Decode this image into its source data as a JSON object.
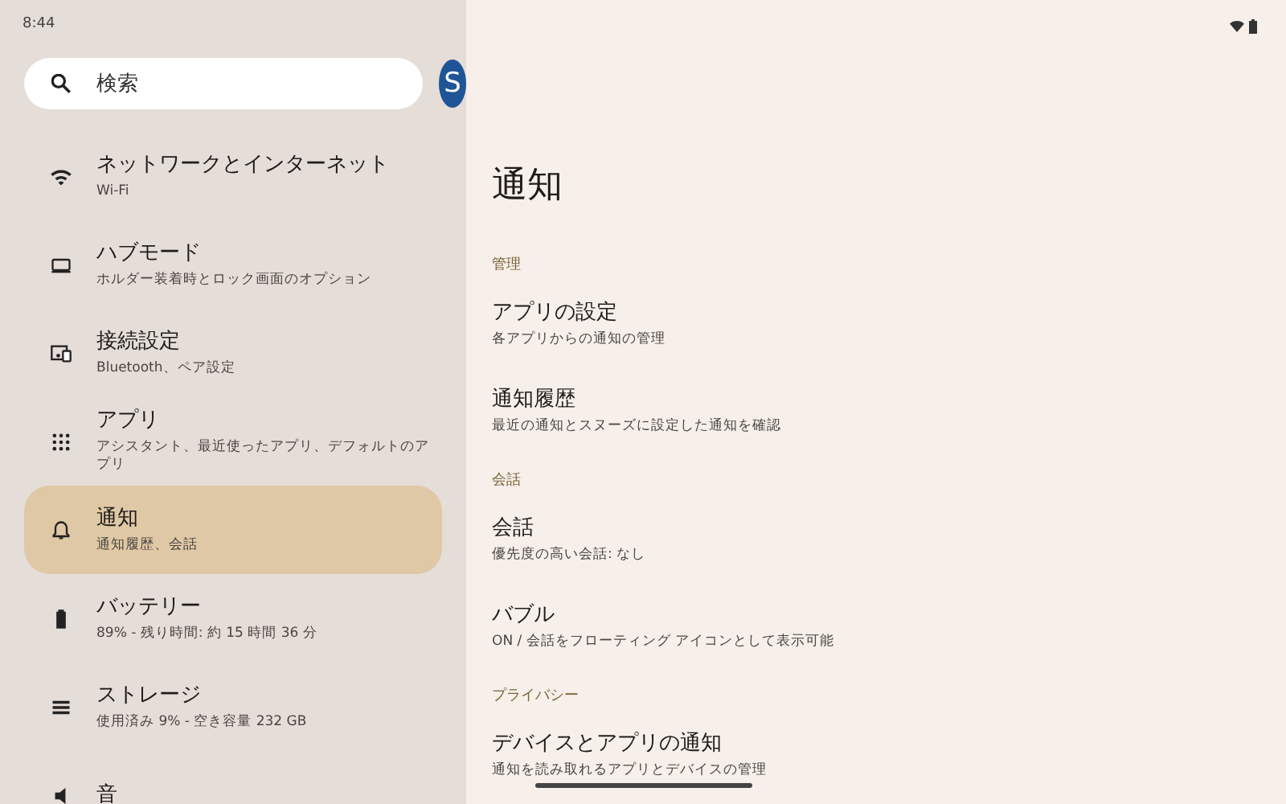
{
  "status_bar": {
    "time": "8:44"
  },
  "search": {
    "placeholder": "検索"
  },
  "account": {
    "initial": "S"
  },
  "sidebar": {
    "items": [
      {
        "title": "ネットワークとインターネット",
        "subtitle": "Wi-Fi",
        "selected": false
      },
      {
        "title": "ハブモード",
        "subtitle": "ホルダー装着時とロック画面のオプション",
        "selected": false
      },
      {
        "title": "接続設定",
        "subtitle": "Bluetooth、ペア設定",
        "selected": false
      },
      {
        "title": "アプリ",
        "subtitle": "アシスタント、最近使ったアプリ、デフォルトのアプリ",
        "selected": false
      },
      {
        "title": "通知",
        "subtitle": "通知履歴、会話",
        "selected": true
      },
      {
        "title": "バッテリー",
        "subtitle": "89% - 残り時間: 約 15 時間 36 分",
        "selected": false
      },
      {
        "title": "ストレージ",
        "subtitle": "使用済み 9% - 空き容量 232 GB",
        "selected": false
      },
      {
        "title": "音",
        "selected": false
      }
    ]
  },
  "page": {
    "title": "通知",
    "sections": [
      {
        "header": "管理",
        "items": [
          {
            "title": "アプリの設定",
            "subtitle": "各アプリからの通知の管理"
          },
          {
            "title": "通知履歴",
            "subtitle": "最近の通知とスヌーズに設定した通知を確認"
          }
        ]
      },
      {
        "header": "会話",
        "items": [
          {
            "title": "会話",
            "subtitle": "優先度の高い会話: なし"
          },
          {
            "title": "バブル",
            "subtitle": "ON / 会話をフローティング アイコンとして表示可能"
          }
        ]
      },
      {
        "header": "プライバシー",
        "items": [
          {
            "title": "デバイスとアプリの通知",
            "subtitle": "通知を読み取れるアプリとデバイスの管理"
          }
        ]
      }
    ]
  }
}
